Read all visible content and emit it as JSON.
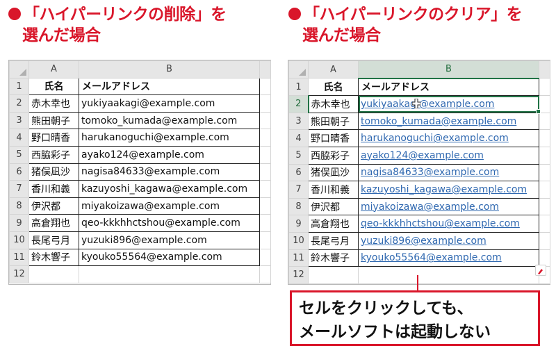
{
  "left": {
    "heading_line1": "「ハイパーリンクの削除」を",
    "heading_line2": "選んだ場合"
  },
  "right": {
    "heading_line1": "「ハイパーリンクのクリア」を",
    "heading_line2": "選んだ場合"
  },
  "columns": {
    "row_header": "",
    "a": "A",
    "b": "B"
  },
  "header_row": {
    "row": "1",
    "name": "氏名",
    "email": "メールアドレス"
  },
  "rows": [
    {
      "row": "2",
      "name": "赤木幸也",
      "email": "yukiyaakagi@example.com"
    },
    {
      "row": "3",
      "name": "熊田朝子",
      "email": "tomoko_kumada@example.com"
    },
    {
      "row": "4",
      "name": "野口晴香",
      "email": "harukanoguchi@example.com"
    },
    {
      "row": "5",
      "name": "西脇彩子",
      "email": "ayako124@example.com"
    },
    {
      "row": "6",
      "name": "猪俣凪沙",
      "email": "nagisa84633@example.com"
    },
    {
      "row": "7",
      "name": "香川和義",
      "email": "kazuyoshi_kagawa@example.com"
    },
    {
      "row": "8",
      "name": "伊沢都",
      "email": "miyakoizawa@example.com"
    },
    {
      "row": "9",
      "name": "高倉翔也",
      "email": "qeo-kkkhhctshou@example.com"
    },
    {
      "row": "10",
      "name": "長尾弓月",
      "email": "yuzuki896@example.com"
    },
    {
      "row": "11",
      "name": "鈴木響子",
      "email": "kyouko55564@example.com"
    }
  ],
  "empty_row": "12",
  "callout": {
    "line1": "セルをクリックしても、",
    "line2": "メールソフトは起動しない"
  },
  "colors": {
    "accent": "#d9162a",
    "excel_green": "#217346",
    "link": "#2f68b0"
  }
}
